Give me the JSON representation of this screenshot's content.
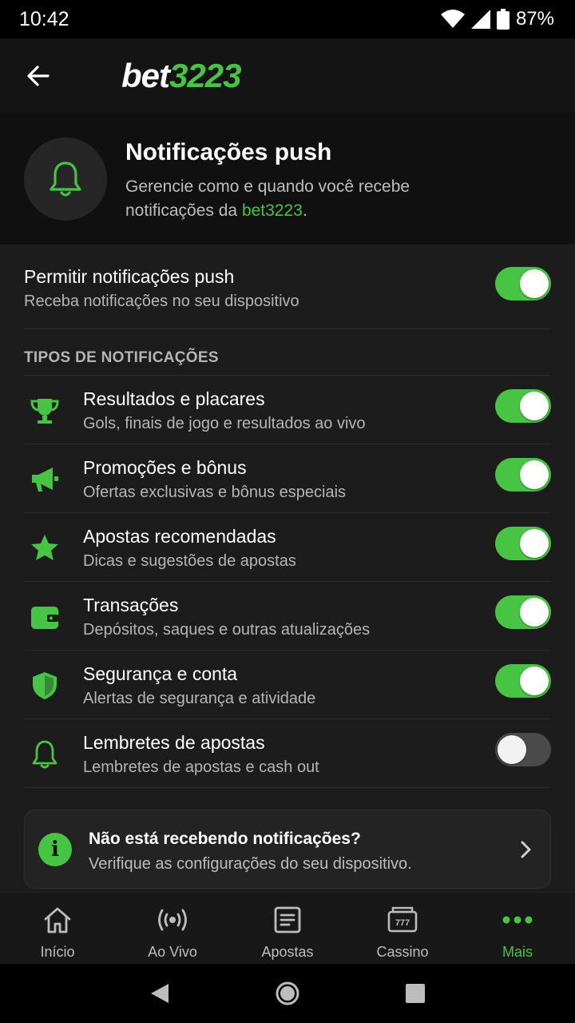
{
  "status_bar": {
    "time": "10:42",
    "battery": "87%"
  },
  "app_bar": {
    "logo_prefix": "bet",
    "logo_number": "3223"
  },
  "header": {
    "title": "Notificações push",
    "description": "Gerencie como e quando você recebe notificações da ",
    "brand": "bet3223",
    "suffix": "."
  },
  "master_toggle": {
    "title": "Permitir notificações push",
    "subtitle": "Receba notificações no seu dispositivo",
    "enabled": true
  },
  "types_section": {
    "label": "TIPOS DE NOTIFICAÇÕES",
    "items": [
      {
        "icon": "trophy-icon",
        "title": "Resultados e placares",
        "subtitle": "Gols, finais de jogo e resultados ao vivo",
        "enabled": true
      },
      {
        "icon": "megaphone-icon",
        "title": "Promoções e bônus",
        "subtitle": "Ofertas exclusivas e bônus especiais",
        "enabled": true
      },
      {
        "icon": "star-icon",
        "title": "Apostas recomendadas",
        "subtitle": "Dicas e sugestões de apostas",
        "enabled": true
      },
      {
        "icon": "wallet-icon",
        "title": "Transações",
        "subtitle": "Depósitos, saques e outras atualizações",
        "enabled": true
      },
      {
        "icon": "shield-icon",
        "title": "Segurança e conta",
        "subtitle": "Alertas de segurança e atividade",
        "enabled": true
      },
      {
        "icon": "bell-icon",
        "title": "Lembretes de apostas",
        "subtitle": "Lembretes de apostas e cash out",
        "enabled": false
      }
    ]
  },
  "help_card": {
    "icon_text": "i",
    "title": "Não está recebendo notificações?",
    "subtitle": "Verifique as configurações do seu dispositivo."
  },
  "bottom_nav": {
    "items": [
      {
        "label": "Início",
        "icon": "home-icon",
        "active": false
      },
      {
        "label": "Ao Vivo",
        "icon": "live-broadcast-icon",
        "active": false
      },
      {
        "label": "Apostas",
        "icon": "betslip-icon",
        "active": false
      },
      {
        "label": "Cassino",
        "icon": "slot-machine-icon",
        "active": false
      },
      {
        "label": "Mais",
        "icon": "more-dots-icon",
        "active": true
      }
    ]
  },
  "colors": {
    "accent": "#48c445",
    "background": "#1c1c1c",
    "toggle_off": "#4a4a4a"
  }
}
